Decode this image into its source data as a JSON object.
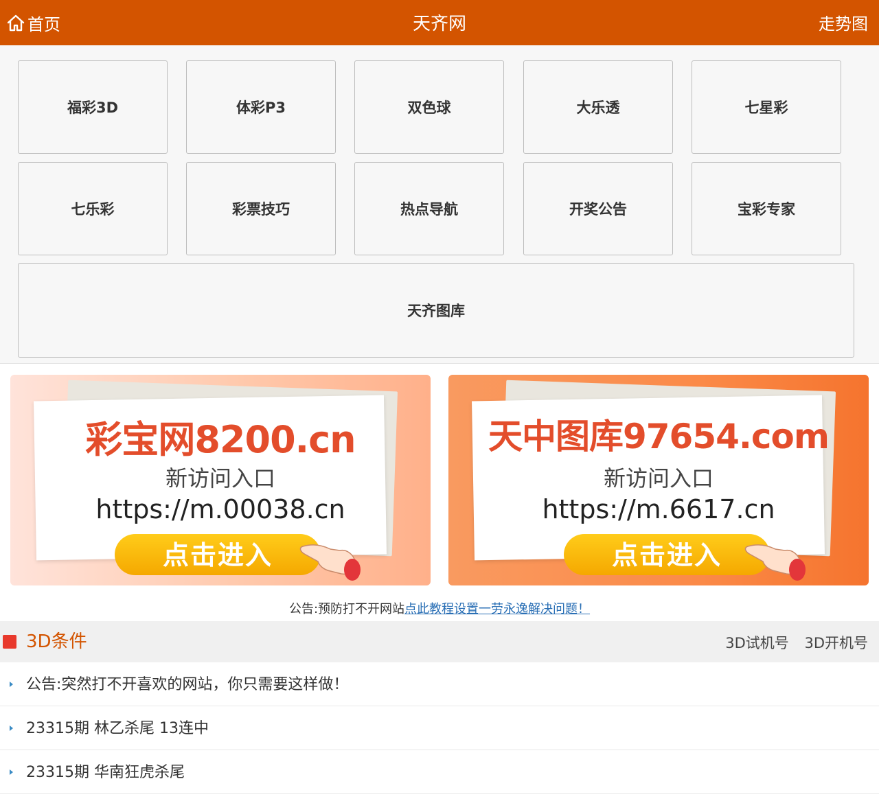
{
  "header": {
    "home_label": "首页",
    "title": "天齐网",
    "trend_label": "走势图"
  },
  "nav": {
    "items": [
      "福彩3D",
      "体彩P3",
      "双色球",
      "大乐透",
      "七星彩",
      "七乐彩",
      "彩票技巧",
      "热点导航",
      "开奖公告",
      "宝彩专家"
    ],
    "wide_item": "天齐图库"
  },
  "banners": [
    {
      "brand": "彩宝网8200.cn",
      "subtitle": "新访问入口",
      "url": "https://m.00038.cn",
      "button": "点击进入"
    },
    {
      "brand": "天中图库97654.com",
      "subtitle": "新访问入口",
      "url": "https://m.6617.cn",
      "button": "点击进入"
    }
  ],
  "notice": {
    "prefix": "公告:预防打不开网站",
    "link": "点此教程设置一劳永逸解决问题！"
  },
  "section": {
    "title": "3D条件",
    "links": [
      "3D试机号",
      "3D开机号"
    ]
  },
  "list": [
    "公告:突然打不开喜欢的网站，你只需要这样做！",
    "23315期 林乙杀尾 13连中",
    "23315期 华南狂虎杀尾"
  ],
  "colors": {
    "header_bg": "#d35400",
    "accent": "#d35400",
    "link": "#2a6fb5",
    "section_mark": "#e8392c",
    "button_yellow": "#f5b400"
  }
}
